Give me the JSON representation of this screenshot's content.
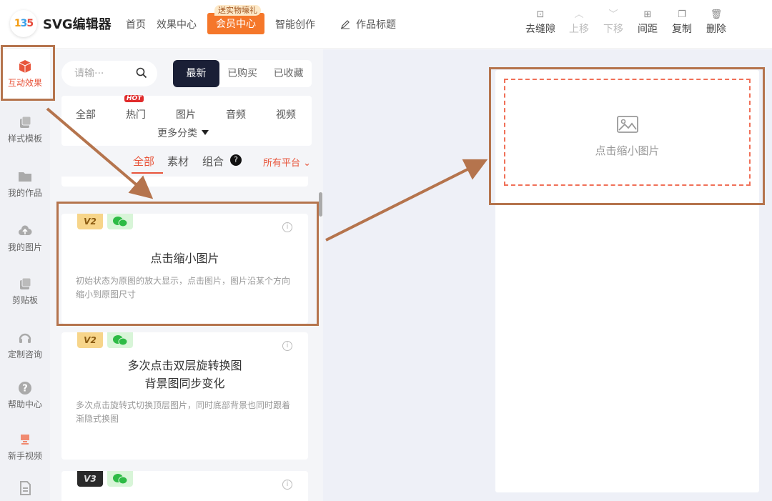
{
  "header": {
    "brand": "SVG编辑器",
    "nav": [
      "首页",
      "效果中心"
    ],
    "vip_label": "会员中心",
    "vip_tag": "送实物壕礼",
    "ai_label": "智能创作",
    "title_label": "作品标题",
    "tools": [
      {
        "label": "去缝隙",
        "icon": "grid-icon",
        "disabled": false
      },
      {
        "label": "上移",
        "icon": "arrow-up-icon",
        "disabled": true
      },
      {
        "label": "下移",
        "icon": "arrow-down-icon",
        "disabled": true
      },
      {
        "label": "间距",
        "icon": "spacing-icon",
        "disabled": false
      },
      {
        "label": "复制",
        "icon": "copy-icon",
        "disabled": false
      },
      {
        "label": "删除",
        "icon": "trash-icon",
        "disabled": false
      }
    ]
  },
  "sidebar": {
    "items": [
      {
        "label": "互动效果",
        "icon": "cube-icon",
        "active": true
      },
      {
        "label": "样式模板",
        "icon": "template-icon",
        "active": false
      },
      {
        "label": "我的作品",
        "icon": "folder-icon",
        "active": false
      },
      {
        "label": "我的图片",
        "icon": "cloud-upload-icon",
        "active": false
      },
      {
        "label": "剪贴板",
        "icon": "clipboard-icon",
        "active": false
      },
      {
        "label": "定制咨询",
        "icon": "headset-icon",
        "active": false
      },
      {
        "label": "帮助中心",
        "icon": "help-icon",
        "active": false
      },
      {
        "label": "新手视频",
        "icon": "video-icon",
        "active": false
      }
    ]
  },
  "panel": {
    "search_placeholder": "请输···",
    "segments": [
      "最新",
      "已购买",
      "已收藏"
    ],
    "categories": [
      "全部",
      "热门",
      "图片",
      "音频",
      "视频"
    ],
    "hot_badge": "HOT",
    "more_label": "更多分类",
    "filters": [
      "全部",
      "素材",
      "组合"
    ],
    "help_mark": "?",
    "platform_label": "所有平台",
    "cards": [
      {
        "version": "V2",
        "title": "点击缩小图片",
        "title2": "",
        "desc": "初始状态为原图的放大显示，点击图片，图片沿某个方向缩小到原图尺寸"
      },
      {
        "version": "V2",
        "title": "多次点击双层旋转换图",
        "title2": "背景图同步变化",
        "desc": "多次点击旋转式切换顶层图片，同时底部背景也同时跟着渐隐式换图"
      },
      {
        "version": "V3",
        "title": "",
        "title2": "",
        "desc": ""
      }
    ]
  },
  "canvas": {
    "placeholder_text": "点击缩小图片"
  },
  "colors": {
    "accent": "#e8553b",
    "vip": "#f5772a",
    "highlight": "#b5744d",
    "dark_segment": "#1a1f36"
  }
}
